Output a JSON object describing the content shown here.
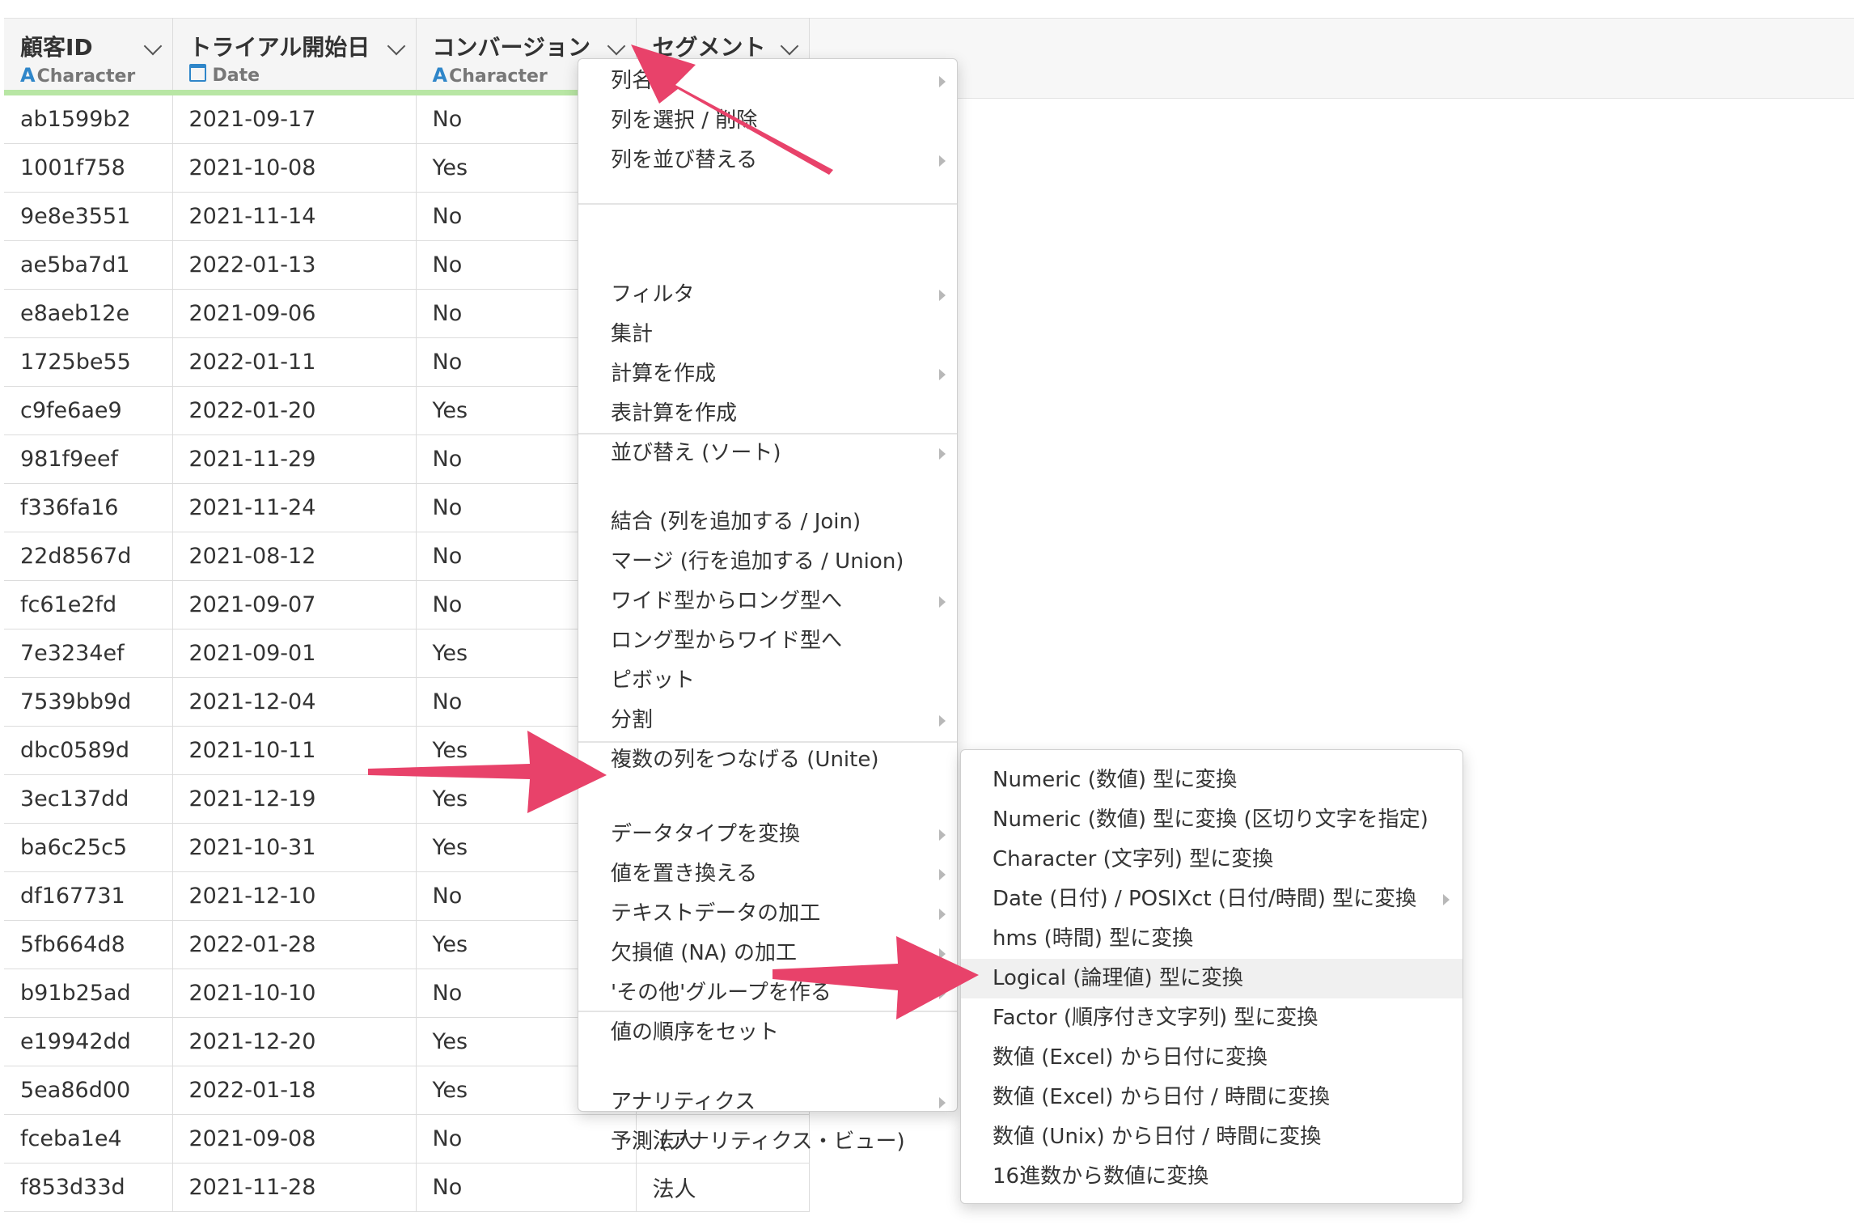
{
  "columns": [
    {
      "title": "顧客ID",
      "type_label": "Character",
      "type_icon": "A"
    },
    {
      "title": "トライアル開始日",
      "type_label": "Date",
      "type_icon": "calendar-icon"
    },
    {
      "title": "コンバージョン",
      "type_label": "Character",
      "type_icon": "A"
    },
    {
      "title": "セグメント",
      "type_label": "",
      "type_icon": ""
    }
  ],
  "rows": [
    [
      "ab1599b2",
      "2021-09-17",
      "No",
      ""
    ],
    [
      "1001f758",
      "2021-10-08",
      "Yes",
      ""
    ],
    [
      "9e8e3551",
      "2021-11-14",
      "No",
      ""
    ],
    [
      "ae5ba7d1",
      "2022-01-13",
      "No",
      ""
    ],
    [
      "e8aeb12e",
      "2021-09-06",
      "No",
      ""
    ],
    [
      "1725be55",
      "2022-01-11",
      "No",
      ""
    ],
    [
      "c9fe6ae9",
      "2022-01-20",
      "Yes",
      ""
    ],
    [
      "981f9eef",
      "2021-11-29",
      "No",
      ""
    ],
    [
      "f336fa16",
      "2021-11-24",
      "No",
      ""
    ],
    [
      "22d8567d",
      "2021-08-12",
      "No",
      ""
    ],
    [
      "fc61e2fd",
      "2021-09-07",
      "No",
      ""
    ],
    [
      "7e3234ef",
      "2021-09-01",
      "Yes",
      ""
    ],
    [
      "7539bb9d",
      "2021-12-04",
      "No",
      ""
    ],
    [
      "dbc0589d",
      "2021-10-11",
      "Yes",
      ""
    ],
    [
      "3ec137dd",
      "2021-12-19",
      "Yes",
      ""
    ],
    [
      "ba6c25c5",
      "2021-10-31",
      "Yes",
      ""
    ],
    [
      "df167731",
      "2021-12-10",
      "No",
      ""
    ],
    [
      "5fb664d8",
      "2022-01-28",
      "Yes",
      ""
    ],
    [
      "b91b25ad",
      "2021-10-10",
      "No",
      ""
    ],
    [
      "e19942dd",
      "2021-12-20",
      "Yes",
      ""
    ],
    [
      "5ea86d00",
      "2022-01-18",
      "Yes",
      ""
    ],
    [
      "fceba1e4",
      "2021-09-08",
      "No",
      "法人"
    ],
    [
      "f853d33d",
      "2021-11-28",
      "No",
      "法人"
    ]
  ],
  "context_menu": {
    "items": [
      {
        "label": "列名",
        "submenu": true
      },
      {
        "label": "列を選択 / 削除",
        "submenu": false
      },
      {
        "label": "列を並び替える",
        "submenu": true
      },
      {
        "label": "フィルタ",
        "submenu": true
      },
      {
        "label": "集計",
        "submenu": false
      },
      {
        "label": "計算を作成",
        "submenu": true
      },
      {
        "label": "表計算を作成",
        "submenu": false
      },
      {
        "label": "並び替え (ソート)",
        "submenu": true
      },
      {
        "label": "結合 (列を追加する / Join)",
        "submenu": false
      },
      {
        "label": "マージ (行を追加する / Union)",
        "submenu": false
      },
      {
        "label": "ワイド型からロング型へ",
        "submenu": true
      },
      {
        "label": "ロング型からワイド型へ",
        "submenu": false
      },
      {
        "label": "ピボット",
        "submenu": false
      },
      {
        "label": "分割",
        "submenu": true
      },
      {
        "label": "複数の列をつなげる (Unite)",
        "submenu": false
      },
      {
        "label": "データタイプを変換",
        "submenu": true
      },
      {
        "label": "値を置き換える",
        "submenu": true
      },
      {
        "label": "テキストデータの加工",
        "submenu": true
      },
      {
        "label": "欠損値 (NA) の加工",
        "submenu": true
      },
      {
        "label": "'その他'グループを作る",
        "submenu": true
      },
      {
        "label": "値の順序をセット",
        "submenu": false
      },
      {
        "label": "アナリティクス",
        "submenu": true
      },
      {
        "label": "予測 (アナリティクス・ビュー)",
        "submenu": false
      }
    ]
  },
  "submenu": {
    "items": [
      {
        "label": "Numeric (数値) 型に変換",
        "submenu": false,
        "highlighted": false
      },
      {
        "label": "Numeric (数値) 型に変換 (区切り文字を指定)",
        "submenu": false,
        "highlighted": false
      },
      {
        "label": "Character (文字列) 型に変換",
        "submenu": false,
        "highlighted": false
      },
      {
        "label": "Date (日付) / POSIXct (日付/時間) 型に変換",
        "submenu": true,
        "highlighted": false
      },
      {
        "label": "hms (時間) 型に変換",
        "submenu": false,
        "highlighted": false
      },
      {
        "label": "Logical (論理値) 型に変換",
        "submenu": false,
        "highlighted": true
      },
      {
        "label": "Factor (順序付き文字列) 型に変換",
        "submenu": false,
        "highlighted": false
      },
      {
        "label": "数値 (Excel) から日付に変換",
        "submenu": false,
        "highlighted": false
      },
      {
        "label": "数値 (Excel) から日付 / 時間に変換",
        "submenu": false,
        "highlighted": false
      },
      {
        "label": "数値 (Unix) から日付 / 時間に変換",
        "submenu": false,
        "highlighted": false
      },
      {
        "label": "16進数から数値に変換",
        "submenu": false,
        "highlighted": false
      }
    ]
  },
  "colors": {
    "arrow": "#e8426a",
    "header_bg": "#f5f5f5",
    "type_accent": "#2f86c9",
    "header_underline": "#b8e6a4",
    "highlight_bg": "#f0f0f0"
  }
}
